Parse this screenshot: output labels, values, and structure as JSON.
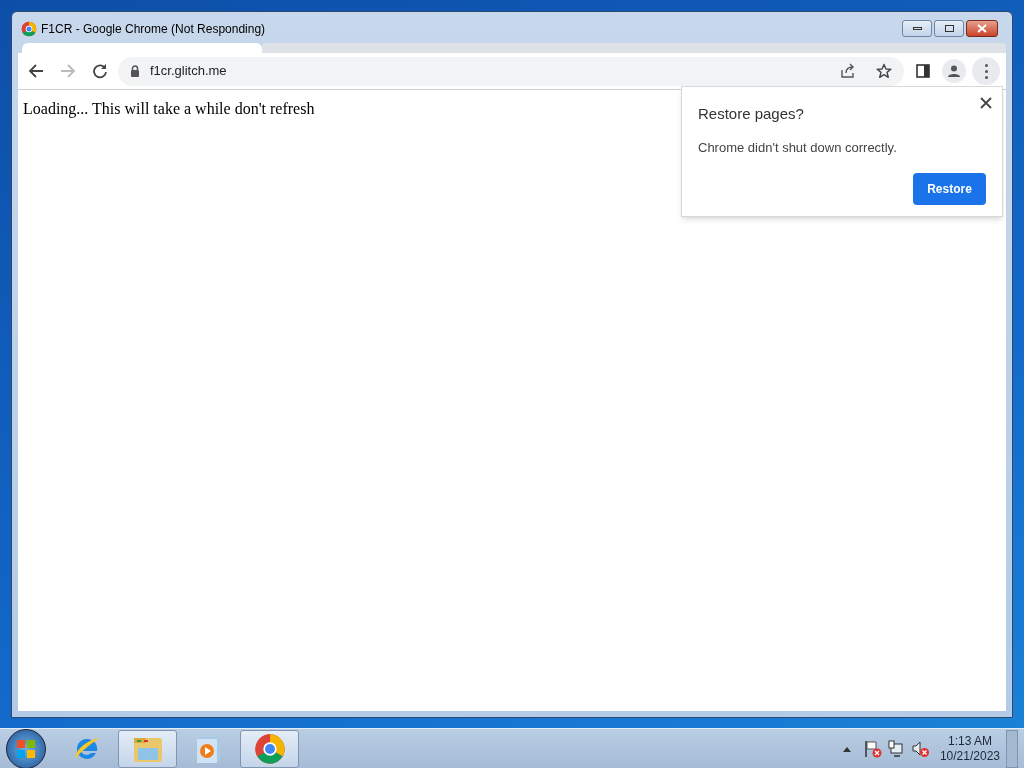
{
  "window": {
    "title": "F1CR - Google Chrome (Not Responding)"
  },
  "toolbar": {
    "address": "f1cr.glitch.me"
  },
  "page": {
    "text": "Loading... This will take a while don't refresh"
  },
  "restore_popup": {
    "title": "Restore pages?",
    "message": "Chrome didn't shut down correctly.",
    "button": "Restore"
  },
  "taskbar": {
    "items": [
      {
        "kind": "ie",
        "running": false
      },
      {
        "kind": "explorer",
        "running": true
      },
      {
        "kind": "media",
        "running": false
      },
      {
        "kind": "chrome",
        "running": true
      }
    ],
    "clock": {
      "time": "1:13 AM",
      "date": "10/21/2023"
    }
  }
}
